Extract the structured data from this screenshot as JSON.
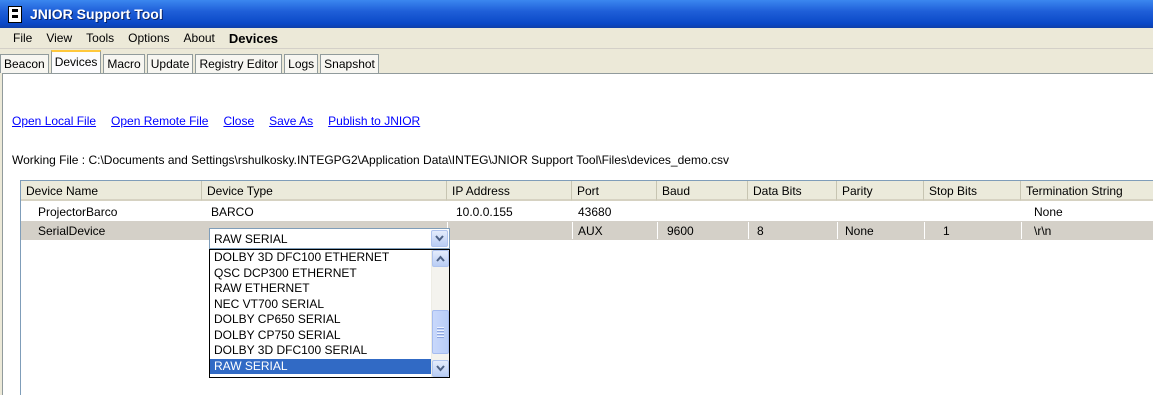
{
  "window": {
    "title": "JNIOR Support Tool"
  },
  "menu": [
    "File",
    "View",
    "Tools",
    "Options",
    "About",
    "Devices"
  ],
  "tabs": [
    {
      "label": "Beacon",
      "active": false
    },
    {
      "label": "Devices",
      "active": true
    },
    {
      "label": "Macro",
      "active": false
    },
    {
      "label": "Update",
      "active": false
    },
    {
      "label": "Registry Editor",
      "active": false
    },
    {
      "label": "Logs",
      "active": false
    },
    {
      "label": "Snapshot",
      "active": false
    }
  ],
  "links": [
    "Open Local File",
    "Open Remote File",
    "Close",
    "Save As",
    "Publish to JNIOR"
  ],
  "working_file": "Working File : C:\\Documents and Settings\\rshulkosky.INTEGPG2\\Application Data\\INTEG\\JNIOR Support Tool\\Files\\devices_demo.csv",
  "table": {
    "columns": [
      "Device Name",
      "Device Type",
      "IP Address",
      "Port",
      "Baud",
      "Data Bits",
      "Parity",
      "Stop Bits",
      "Termination String"
    ],
    "rows": [
      [
        "ProjectorBarco",
        "BARCO",
        "10.0.0.155",
        "43680",
        "",
        "",
        "",
        "",
        "None"
      ],
      [
        "SerialDevice",
        "RAW SERIAL",
        "",
        "AUX",
        "9600",
        "8",
        "None",
        "1",
        "\\r\\n"
      ]
    ]
  },
  "dropdown": {
    "selected": "RAW SERIAL",
    "options": [
      "DOLBY 3D DFC100 ETHERNET",
      "QSC DCP300 ETHERNET",
      "RAW ETHERNET",
      "NEC VT700 SERIAL",
      "DOLBY CP650 SERIAL",
      "DOLBY CP750 SERIAL",
      "DOLBY 3D DFC100 SERIAL",
      "RAW SERIAL"
    ]
  },
  "colors": {
    "title_bar": "#0a48c7",
    "selection": "#316ac5",
    "active_tab_accent": "#ffc83c",
    "link": "#0000ff"
  }
}
